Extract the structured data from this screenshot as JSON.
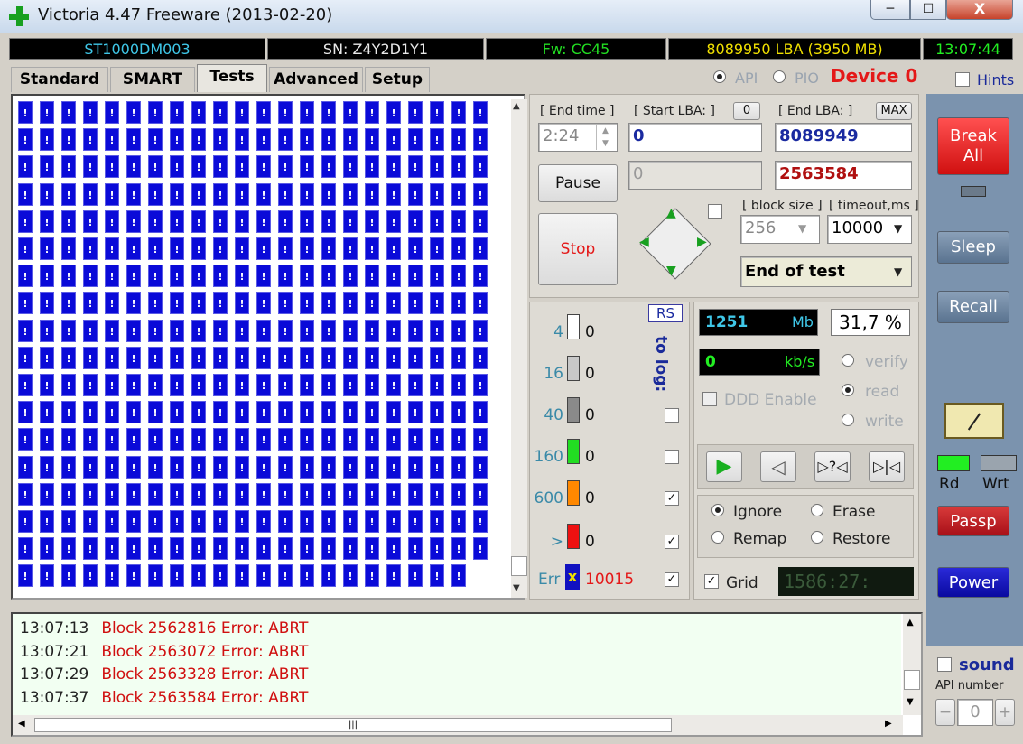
{
  "window": {
    "title": "Victoria 4.47  Freeware (2013-02-20)",
    "min_label": "─",
    "max_label": "☐",
    "close_label": "X"
  },
  "status": {
    "model": "ST1000DM003",
    "serial": "SN: Z4Y2D1Y1",
    "firmware": "Fw: CC45",
    "capacity": "8089950 LBA (3950 MB)",
    "clock": "13:07:44"
  },
  "tabs": [
    "Standard",
    "SMART",
    "Tests",
    "Advanced",
    "Setup"
  ],
  "active_tab": "Tests",
  "mode": {
    "api": "API",
    "pio": "PIO",
    "device": "Device 0",
    "hints": "Hints"
  },
  "map": {
    "block_glyph": "!",
    "cols": 22,
    "rows": 18,
    "last_row_count": 21
  },
  "params": {
    "end_time_label": "[ End time ]",
    "end_time_value": "2:24",
    "start_lba_label": "[ Start LBA: ]",
    "start_lba_reset": "0",
    "start_lba_value": "0",
    "current_lba_value": "0",
    "end_lba_label": "[ End LBA: ]",
    "end_lba_max": "MAX",
    "end_lba_value": "8089949",
    "position_value": "2563584",
    "block_size_label": "[ block size ]",
    "block_size_value": "256",
    "timeout_label": "[ timeout,ms ]",
    "timeout_value": "10000",
    "end_action": "End of test"
  },
  "controls": {
    "pause": "Pause",
    "stop": "Stop"
  },
  "stats": {
    "rs": "RS",
    "to_log": "to log:",
    "rows": [
      {
        "label": "4",
        "count": "0",
        "color": "#ffffff",
        "logged": null
      },
      {
        "label": "16",
        "count": "0",
        "color": "#c8c8c8",
        "logged": null
      },
      {
        "label": "40",
        "count": "0",
        "color": "#8a8a8a",
        "logged": false
      },
      {
        "label": "160",
        "count": "0",
        "color": "#22dd22",
        "logged": false
      },
      {
        "label": "600",
        "count": "0",
        "color": "#ff8800",
        "logged": true
      },
      {
        "label": ">",
        "count": "0",
        "color": "#ee1111",
        "logged": true
      }
    ],
    "err_label": "Err",
    "err_glyph": "x",
    "err_count": "10015",
    "err_logged": true
  },
  "progress": {
    "mb": "1251",
    "mb_unit": "Mb",
    "percent": "31,7 %",
    "speed": "0",
    "speed_unit": "kb/s",
    "ddd": "DDD Enable"
  },
  "scan_mode": {
    "verify": "verify",
    "read": "read",
    "write": "write",
    "selected": "read"
  },
  "actions": {
    "ignore": "Ignore",
    "erase": "Erase",
    "remap": "Remap",
    "restore": "Restore",
    "selected": "Ignore"
  },
  "grid": {
    "label": "Grid",
    "checked": true,
    "timer": "1586:27:"
  },
  "side": {
    "break_all": "Break All",
    "sleep": "Sleep",
    "recall": "Recall",
    "rd": "Rd",
    "wrt": "Wrt",
    "passp": "Passp",
    "power": "Power",
    "sound": "sound",
    "api_number": "API number",
    "api_minus": "−",
    "api_value": "0",
    "api_plus": "+"
  },
  "log": [
    {
      "time": "13:07:13",
      "msg": "Block 2562816 Error: ABRT"
    },
    {
      "time": "13:07:21",
      "msg": "Block 2563072 Error: ABRT"
    },
    {
      "time": "13:07:29",
      "msg": "Block 2563328 Error: ABRT"
    },
    {
      "time": "13:07:37",
      "msg": "Block 2563584 Error: ABRT"
    }
  ],
  "colors": {
    "block": "#0a0ad8",
    "error_text": "#d01010",
    "break_red": "#e41818",
    "passp_red": "#c81820",
    "power_blue": "#1010c0"
  }
}
